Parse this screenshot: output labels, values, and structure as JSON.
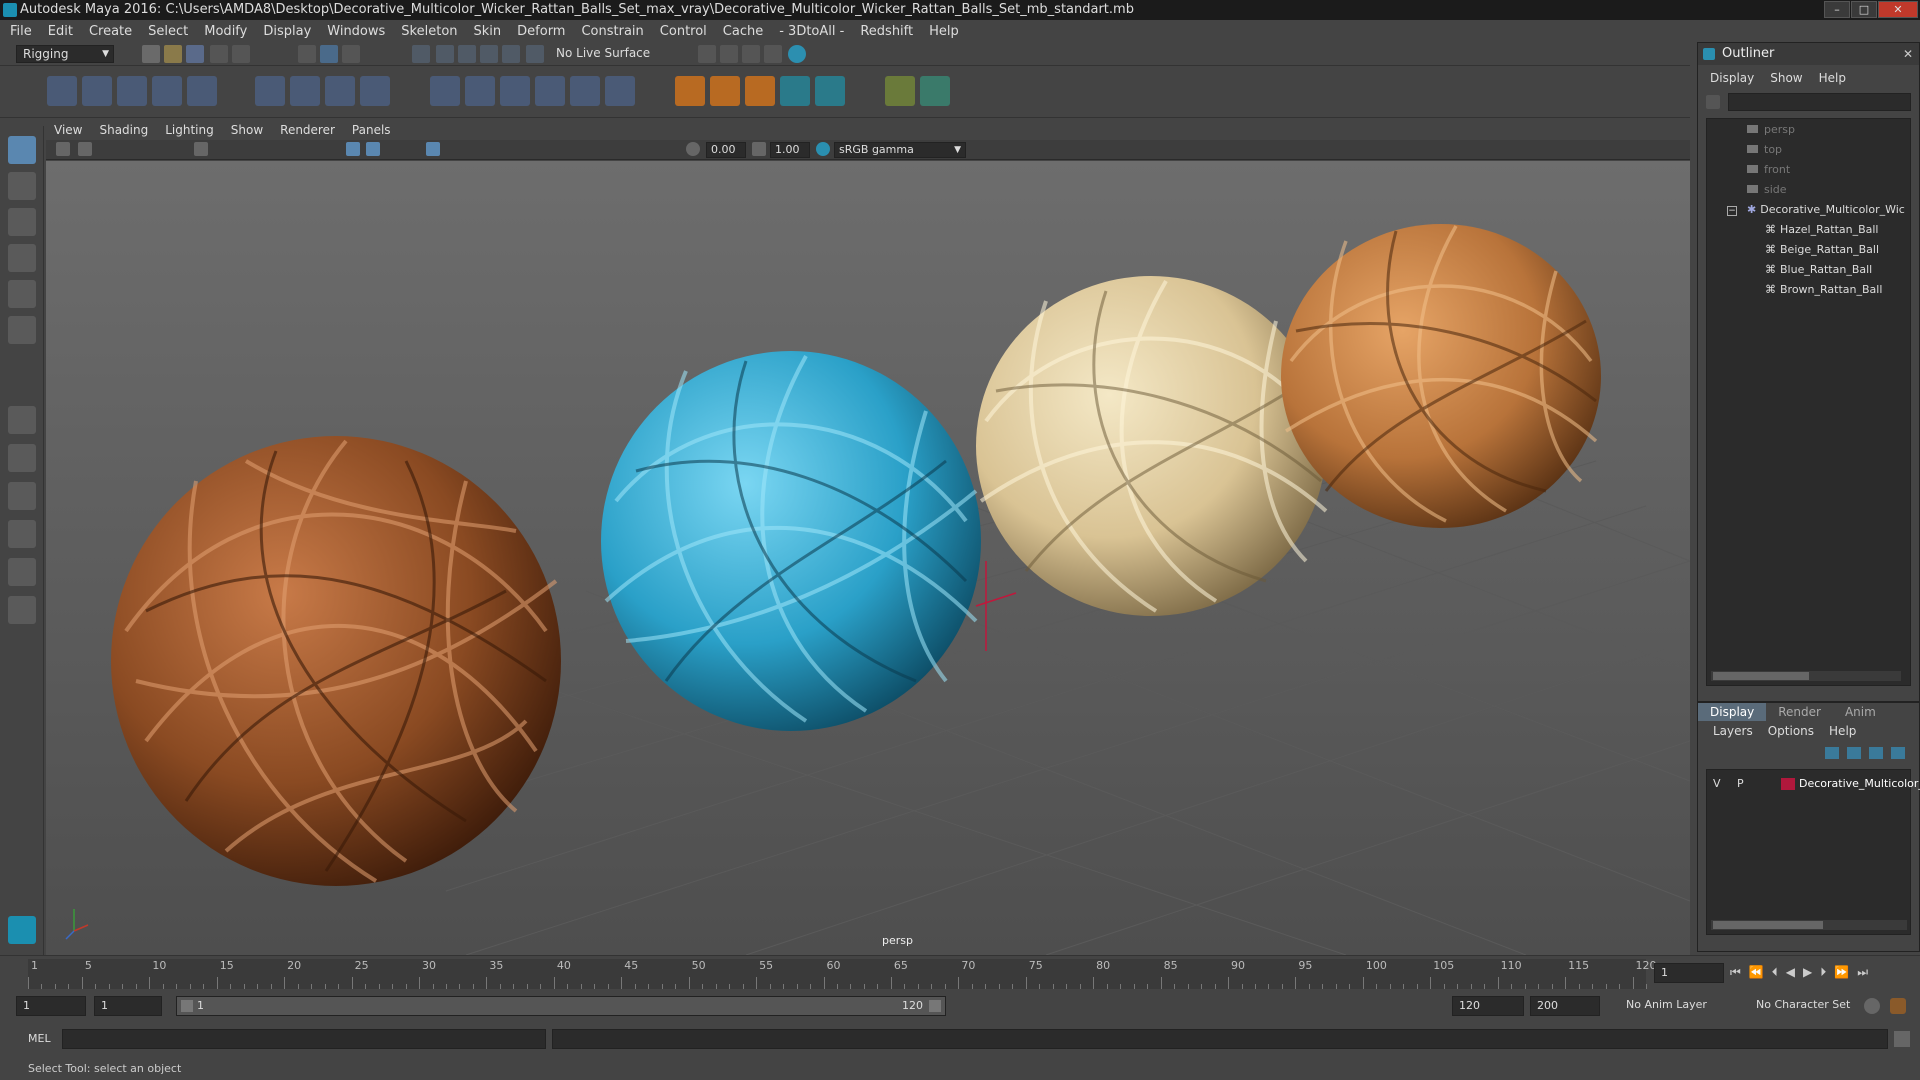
{
  "window": {
    "title": "Autodesk Maya 2016: C:\\Users\\AMDA8\\Desktop\\Decorative_Multicolor_Wicker_Rattan_Balls_Set_max_vray\\Decorative_Multicolor_Wicker_Rattan_Balls_Set_mb_standart.mb",
    "controls": [
      "–",
      "□",
      "✕"
    ]
  },
  "menubar": [
    "File",
    "Edit",
    "Create",
    "Select",
    "Modify",
    "Display",
    "Windows",
    "Skeleton",
    "Skin",
    "Deform",
    "Constrain",
    "Control",
    "Cache",
    "- 3DtoAll -",
    "Redshift",
    "Help"
  ],
  "statusline": {
    "menuset": "Rigging",
    "live_surface": "No Live Surface"
  },
  "viewport": {
    "menu": [
      "View",
      "Shading",
      "Lighting",
      "Show",
      "Renderer",
      "Panels"
    ],
    "exposure": "0.00",
    "gamma": "1.00",
    "colorspace": "sRGB gamma",
    "camera_label": "persp"
  },
  "outliner": {
    "title": "Outliner",
    "menu": [
      "Display",
      "Show",
      "Help"
    ],
    "items": [
      {
        "label": "persp",
        "dim": true
      },
      {
        "label": "top",
        "dim": true
      },
      {
        "label": "front",
        "dim": true
      },
      {
        "label": "side",
        "dim": true
      },
      {
        "label": "Decorative_Multicolor_Wic",
        "dim": false
      },
      {
        "label": "Hazel_Rattan_Ball",
        "dim": false
      },
      {
        "label": "Beige_Rattan_Ball",
        "dim": false
      },
      {
        "label": "Blue_Rattan_Ball",
        "dim": false
      },
      {
        "label": "Brown_Rattan_Ball",
        "dim": false
      }
    ]
  },
  "layer_editor": {
    "tabs": [
      "Display",
      "Render",
      "Anim"
    ],
    "menu": [
      "Layers",
      "Options",
      "Help"
    ],
    "layer": {
      "v": "V",
      "p": "P",
      "name": "Decorative_Multicolor_",
      "color": "#b0183c"
    }
  },
  "timeline": {
    "ticks": [
      "1",
      "5",
      "10",
      "15",
      "20",
      "25",
      "30",
      "35",
      "40",
      "45",
      "50",
      "55",
      "60",
      "65",
      "70",
      "75",
      "80",
      "85",
      "90",
      "95",
      "100",
      "105",
      "110",
      "115",
      "120"
    ],
    "current_frame": "1"
  },
  "range": {
    "start": "1",
    "playback_start": "1",
    "slider_start": "1",
    "slider_end": "120",
    "playback_end": "120",
    "end": "200",
    "anim_layer": "No Anim Layer",
    "character_set": "No Character Set"
  },
  "cmdline": {
    "lang": "MEL"
  },
  "helpline": "Select Tool: select an object",
  "colors": {
    "brown_ball": "#8a4a22",
    "blue_ball": "#2aa0c8",
    "beige_ball": "#d9c394",
    "hazel_ball": "#b8733a"
  }
}
